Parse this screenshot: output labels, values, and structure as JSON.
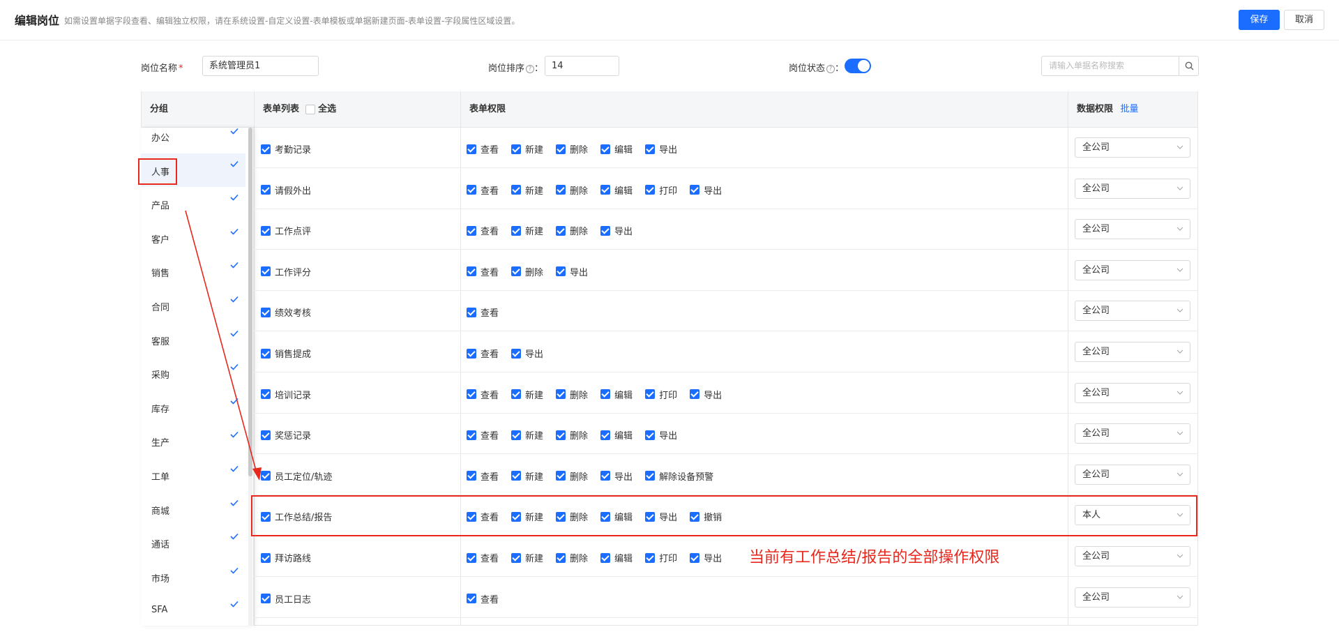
{
  "header": {
    "title": "编辑岗位",
    "hint": "如需设置单据字段查看、编辑独立权限，请在系统设置-自定义设置-表单模板或单据新建页面-表单设置-字段属性区域设置。",
    "save_label": "保存",
    "cancel_label": "取消"
  },
  "form": {
    "name_label": "岗位名称",
    "required_mark": "*",
    "name_value": "系统管理员1",
    "order_label": "岗位排序",
    "order_value": "14",
    "status_label": "岗位状态",
    "status_on": true,
    "colon": "：",
    "search_placeholder": "请输入单据名称搜索"
  },
  "table": {
    "col_group": "分组",
    "col_forms": "表单列表",
    "select_all": "全选",
    "col_perms": "表单权限",
    "col_data": "数据权限",
    "batch": "批量"
  },
  "groups": [
    {
      "name": "办公",
      "checked": true
    },
    {
      "name": "人事",
      "checked": true,
      "active": true
    },
    {
      "name": "产品",
      "checked": true
    },
    {
      "name": "客户",
      "checked": true
    },
    {
      "name": "销售",
      "checked": true
    },
    {
      "name": "合同",
      "checked": true
    },
    {
      "name": "客服",
      "checked": true
    },
    {
      "name": "采购",
      "checked": true
    },
    {
      "name": "库存",
      "checked": true
    },
    {
      "name": "生产",
      "checked": true
    },
    {
      "name": "工单",
      "checked": true
    },
    {
      "name": "商城",
      "checked": true
    },
    {
      "name": "通话",
      "checked": true
    },
    {
      "name": "市场",
      "checked": true
    },
    {
      "name": "SFA",
      "checked": true
    }
  ],
  "rows": [
    {
      "name": "考勤记录",
      "perms": [
        "查看",
        "新建",
        "删除",
        "编辑",
        "导出"
      ],
      "scope": "全公司"
    },
    {
      "name": "请假外出",
      "perms": [
        "查看",
        "新建",
        "删除",
        "编辑",
        "打印",
        "导出"
      ],
      "scope": "全公司"
    },
    {
      "name": "工作点评",
      "perms": [
        "查看",
        "新建",
        "删除",
        "导出"
      ],
      "scope": "全公司"
    },
    {
      "name": "工作评分",
      "perms": [
        "查看",
        "删除",
        "导出"
      ],
      "scope": "全公司"
    },
    {
      "name": "绩效考核",
      "perms": [
        "查看"
      ],
      "scope": "全公司"
    },
    {
      "name": "销售提成",
      "perms": [
        "查看",
        "导出"
      ],
      "scope": "全公司"
    },
    {
      "name": "培训记录",
      "perms": [
        "查看",
        "新建",
        "删除",
        "编辑",
        "打印",
        "导出"
      ],
      "scope": "全公司"
    },
    {
      "name": "奖惩记录",
      "perms": [
        "查看",
        "新建",
        "删除",
        "编辑",
        "导出"
      ],
      "scope": "全公司"
    },
    {
      "name": "员工定位/轨迹",
      "perms": [
        "查看",
        "新建",
        "删除",
        "导出",
        "解除设备预警"
      ],
      "scope": "全公司"
    },
    {
      "name": "工作总结/报告",
      "perms": [
        "查看",
        "新建",
        "删除",
        "编辑",
        "导出",
        "撤销"
      ],
      "scope": "本人"
    },
    {
      "name": "拜访路线",
      "perms": [
        "查看",
        "新建",
        "删除",
        "编辑",
        "打印",
        "导出"
      ],
      "scope": "全公司"
    },
    {
      "name": "员工日志",
      "perms": [
        "查看"
      ],
      "scope": "全公司"
    }
  ],
  "annotation": {
    "note": "当前有工作总结/报告的全部操作权限",
    "color": "#e8271d"
  },
  "colors": {
    "accent": "#1a6dff"
  }
}
